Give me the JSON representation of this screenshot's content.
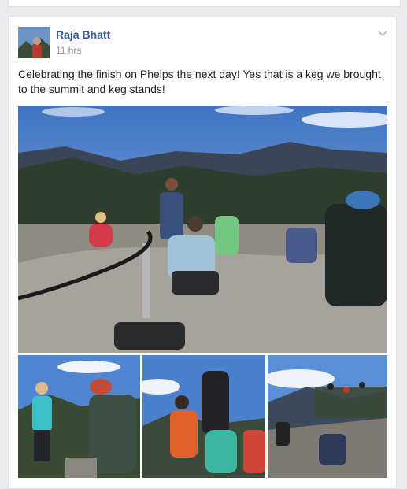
{
  "post": {
    "author": "Raja Bhatt",
    "time": "11 hrs",
    "text": "Celebrating the finish on Phelps the next day! Yes that is a keg we brought to the summit and keg stands!"
  },
  "icons": {
    "options": "chevron-down-icon"
  },
  "colors": {
    "link": "#365899",
    "meta": "#90949c",
    "text": "#1d2129",
    "sky": "#4a7fc9",
    "mountain": "#2e3b4a",
    "rock": "#9a958c"
  }
}
